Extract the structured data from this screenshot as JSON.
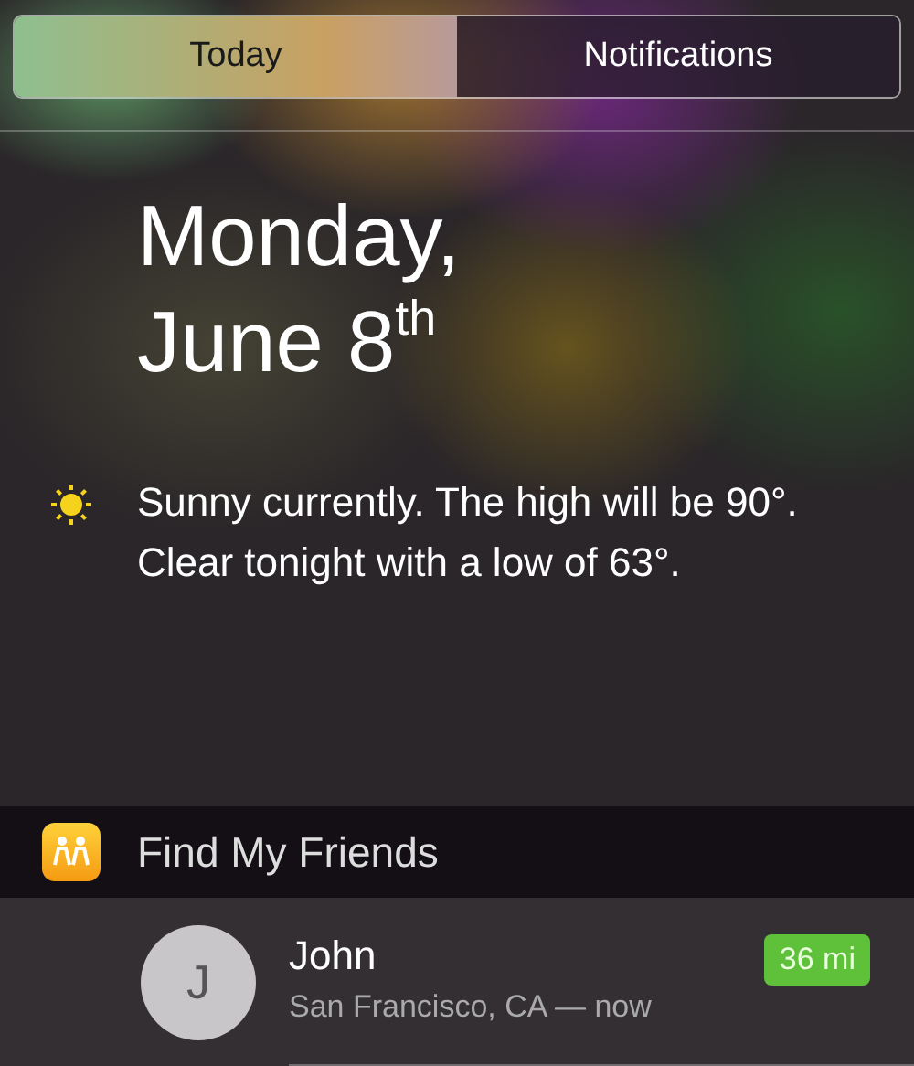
{
  "tabs": [
    {
      "label": "Today",
      "selected": true
    },
    {
      "label": "Notifications",
      "selected": false
    }
  ],
  "date": {
    "lines": [
      "Monday,",
      "June 8$^{th}$"
    ]
  },
  "weather": {
    "summary": "Sunny currently. The high will be 90°. Clear tonight with a low of 63°."
  },
  "widget": {
    "title": "Find My Friends",
    "friends": [
      {
        "initial": "J",
        "name": "John",
        "location": "San Francisco, CA — now",
        "distance": "36 mi"
      }
    ]
  }
}
